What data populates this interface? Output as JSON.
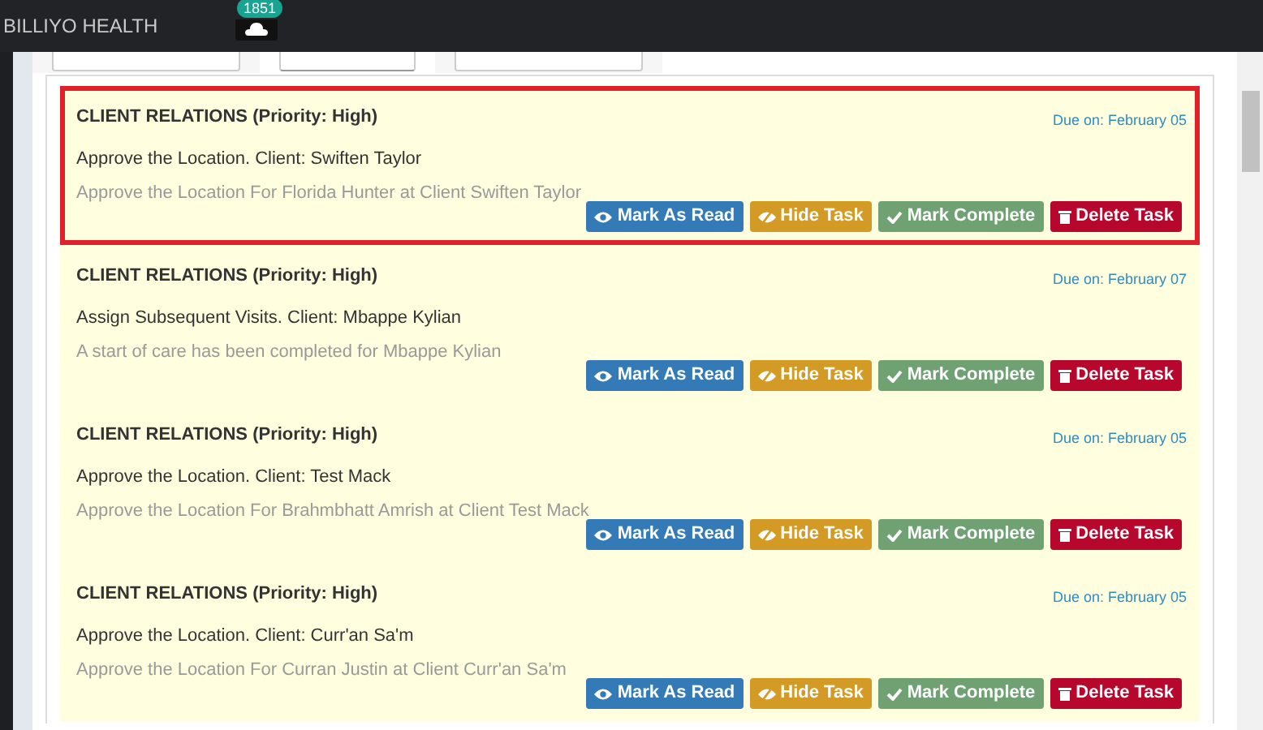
{
  "navbar": {
    "brand": "BILLIYO HEALTH",
    "notification_count": "1851"
  },
  "tabs": [
    {
      "selected": false
    },
    {
      "selected": true
    },
    {
      "selected": false
    }
  ],
  "tasks": [
    {
      "title": "CLIENT RELATIONS (Priority: High)",
      "subject": "Approve the Location. Client: Swiften Taylor",
      "detail": "Approve the Location For Florida Hunter at Client Swiften Taylor",
      "due": "Due on: February 05",
      "highlighted": true,
      "actions": [
        {
          "kind": "read",
          "label": "Mark As Read"
        },
        {
          "kind": "hide",
          "label": "Hide Task"
        },
        {
          "kind": "complete",
          "label": "Mark Complete"
        },
        {
          "kind": "delete",
          "label": "Delete Task"
        }
      ]
    },
    {
      "title": "CLIENT RELATIONS (Priority: High)",
      "subject": "Assign Subsequent Visits. Client: Mbappe Kylian",
      "detail": "A start of care has been completed for Mbappe Kylian",
      "due": "Due on: February 07",
      "highlighted": false,
      "actions": [
        {
          "kind": "read",
          "label": "Mark As Read"
        },
        {
          "kind": "hide",
          "label": "Hide Task"
        },
        {
          "kind": "complete",
          "label": "Mark Complete"
        },
        {
          "kind": "delete",
          "label": "Delete Task"
        }
      ]
    },
    {
      "title": "CLIENT RELATIONS (Priority: High)",
      "subject": "Approve the Location. Client: Test Mack",
      "detail": "Approve the Location For Brahmbhatt Amrish at Client Test Mack",
      "due": "Due on: February 05",
      "highlighted": false,
      "actions": [
        {
          "kind": "read",
          "label": "Mark As Read"
        },
        {
          "kind": "hide",
          "label": "Hide Task"
        },
        {
          "kind": "complete",
          "label": "Mark Complete"
        },
        {
          "kind": "delete",
          "label": "Delete Task"
        }
      ]
    },
    {
      "title": "CLIENT RELATIONS (Priority: High)",
      "subject": "Approve the Location. Client: Curr'an Sa'm",
      "detail": "Approve the Location For Curran Justin at Client Curr'an Sa'm",
      "due": "Due on: February 05",
      "highlighted": false,
      "actions": [
        {
          "kind": "read",
          "label": "Mark As Read"
        },
        {
          "kind": "hide",
          "label": "Hide Task"
        },
        {
          "kind": "complete",
          "label": "Mark Complete"
        },
        {
          "kind": "delete",
          "label": "Delete Task"
        }
      ]
    }
  ]
}
